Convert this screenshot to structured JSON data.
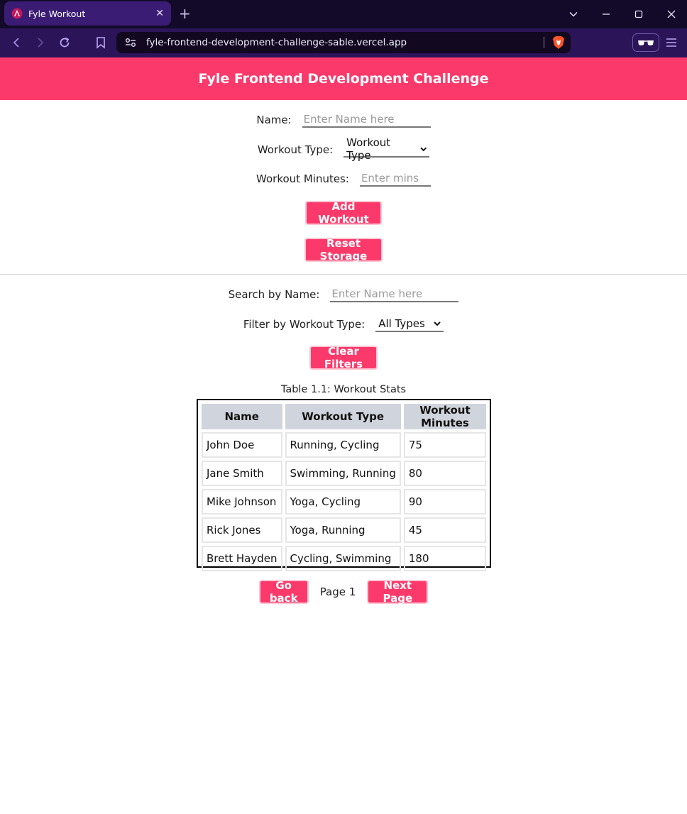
{
  "browser": {
    "tab_title": "Fyle Workout",
    "tab_close": "✕",
    "new_tab": "+",
    "url": "fyle-frontend-development-challenge-sable.vercel.app"
  },
  "header": {
    "title": "Fyle Frontend Development Challenge"
  },
  "form": {
    "name_label": "Name:",
    "name_placeholder": "Enter Name here",
    "name_value": "",
    "type_label": "Workout Type:",
    "type_selected": "Workout Type",
    "minutes_label": "Workout Minutes:",
    "minutes_placeholder": "Enter mins",
    "minutes_value": "",
    "add_button": "Add Workout",
    "reset_button": "Reset Storage"
  },
  "filters": {
    "search_label": "Search by Name:",
    "search_placeholder": "Enter Name here",
    "search_value": "",
    "type_label": "Filter by Workout Type:",
    "type_selected": "All Types",
    "clear_button": "Clear Filters"
  },
  "table": {
    "caption": "Table 1.1: Workout Stats",
    "headers": [
      "Name",
      "Workout Type",
      "Workout Minutes"
    ],
    "rows": [
      [
        "John Doe",
        "Running, Cycling",
        "75"
      ],
      [
        "Jane Smith",
        "Swimming, Running",
        "80"
      ],
      [
        "Mike Johnson",
        "Yoga, Cycling",
        "90"
      ],
      [
        "Rick Jones",
        "Yoga, Running",
        "45"
      ],
      [
        "Brett Hayden",
        "Cycling, Swimming",
        "180"
      ]
    ]
  },
  "pagination": {
    "back_button": "Go back",
    "page_label": "Page 1",
    "next_button": "Next Page"
  },
  "colors": {
    "accent": "#fb3a6b",
    "chrome_dark": "#130a2a",
    "chrome_toolbar": "#2c1458"
  }
}
